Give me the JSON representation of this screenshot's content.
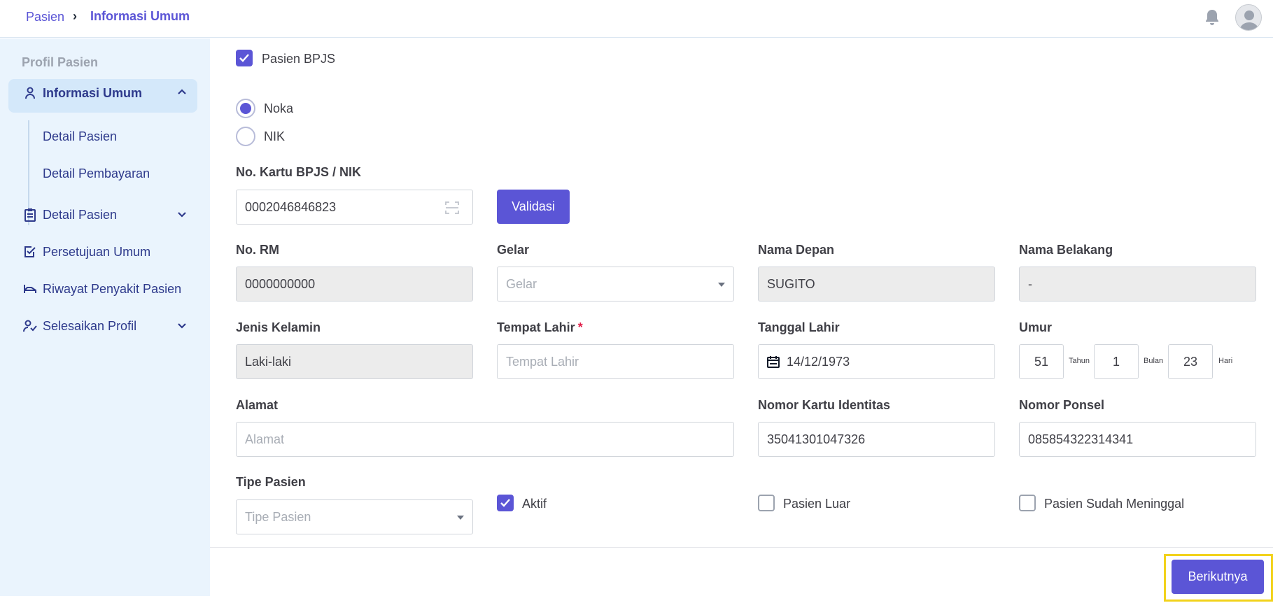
{
  "breadcrumb": {
    "parent": "Pasien",
    "separator": "›",
    "current": "Informasi Umum"
  },
  "sidebar": {
    "title": "Profil Pasien",
    "active": "Informasi Umum",
    "subitems": [
      "Detail Pasien",
      "Detail Pembayaran"
    ],
    "items": [
      "Detail Pasien",
      "Persetujuan Umum",
      "Riwayat Penyakit Pasien",
      "Selesaikan Profil"
    ]
  },
  "form": {
    "bpjs_checkbox": {
      "label": "Pasien BPJS",
      "checked": true
    },
    "id_type": {
      "options": [
        "Noka",
        "NIK"
      ],
      "selected": "Noka"
    },
    "card_number": {
      "label": "No. Kartu BPJS / NIK",
      "value": "0002046846823"
    },
    "validate_button": "Validasi",
    "no_rm": {
      "label": "No. RM",
      "value": "0000000000"
    },
    "gelar": {
      "label": "Gelar",
      "placeholder": "Gelar"
    },
    "nama_depan": {
      "label": "Nama Depan",
      "value": "SUGITO"
    },
    "nama_belakang": {
      "label": "Nama Belakang",
      "value": "-"
    },
    "jenis_kelamin": {
      "label": "Jenis Kelamin",
      "value": "Laki-laki"
    },
    "tempat_lahir": {
      "label": "Tempat Lahir",
      "required_mark": "*",
      "placeholder": "Tempat Lahir"
    },
    "tanggal_lahir": {
      "label": "Tanggal Lahir",
      "value": "14/12/1973"
    },
    "umur": {
      "label": "Umur",
      "tahun": "51",
      "tahun_unit": "Tahun",
      "bulan": "1",
      "bulan_unit": "Bulan",
      "hari": "23",
      "hari_unit": "Hari"
    },
    "alamat": {
      "label": "Alamat",
      "placeholder": "Alamat"
    },
    "nomor_kartu_identitas": {
      "label": "Nomor Kartu Identitas",
      "value": "35041301047326"
    },
    "nomor_ponsel": {
      "label": "Nomor Ponsel",
      "value": "085854322314341"
    },
    "tipe_pasien": {
      "label": "Tipe Pasien",
      "placeholder": "Tipe Pasien"
    },
    "aktif": {
      "label": "Aktif",
      "checked": true
    },
    "pasien_luar": {
      "label": "Pasien Luar",
      "checked": false
    },
    "pasien_meninggal": {
      "label": "Pasien Sudah Meninggal",
      "checked": false
    }
  },
  "next_button": "Berikutnya",
  "colors": {
    "primary": "#5b55d6",
    "sidebar_bg": "#eaf4fd",
    "highlight": "#f2d21b"
  }
}
